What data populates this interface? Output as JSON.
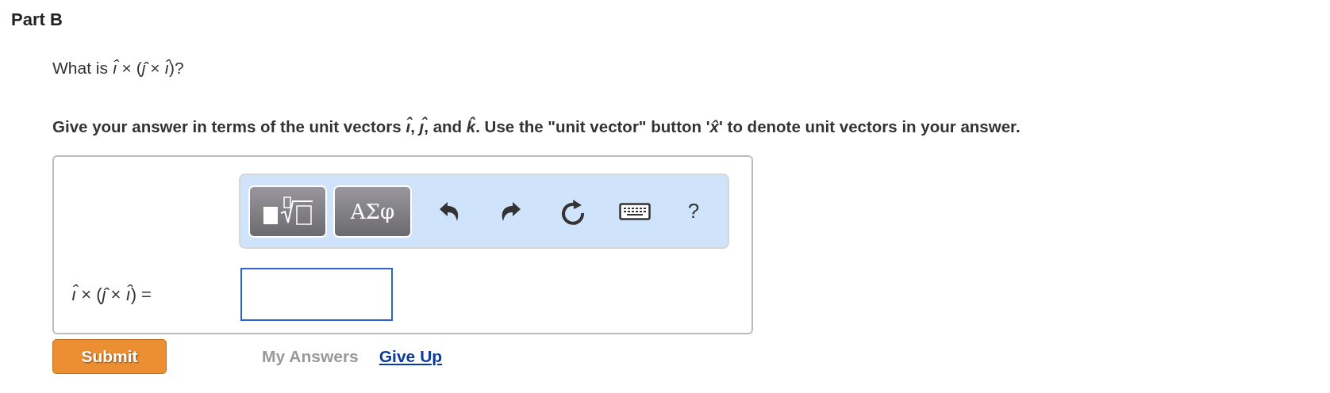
{
  "part_title": "Part B",
  "question": "What is *ı̂* × (*ȷ̂* × *ı̂*)?",
  "instructions": "Give your answer in terms of the unit vectors *ı̂*, *ȷ̂*, and *k̂*. Use the \"unit vector\" button '*x̂*' to denote unit vectors in your answer.",
  "toolbar": [
    {
      "kind": "templates"
    },
    {
      "kind": "symbols",
      "label": "ΑΣφ"
    },
    {
      "kind": "undo"
    },
    {
      "kind": "redo"
    },
    {
      "kind": "reset"
    },
    {
      "kind": "keyboard"
    },
    {
      "kind": "help",
      "label": "?"
    }
  ],
  "answer_label": "*ı̂* × (*ȷ̂* × *ı̂*) =",
  "submit": "Submit",
  "my_answers": {
    "label": "My Answers",
    "disabled": true
  },
  "give_up": "Give Up"
}
